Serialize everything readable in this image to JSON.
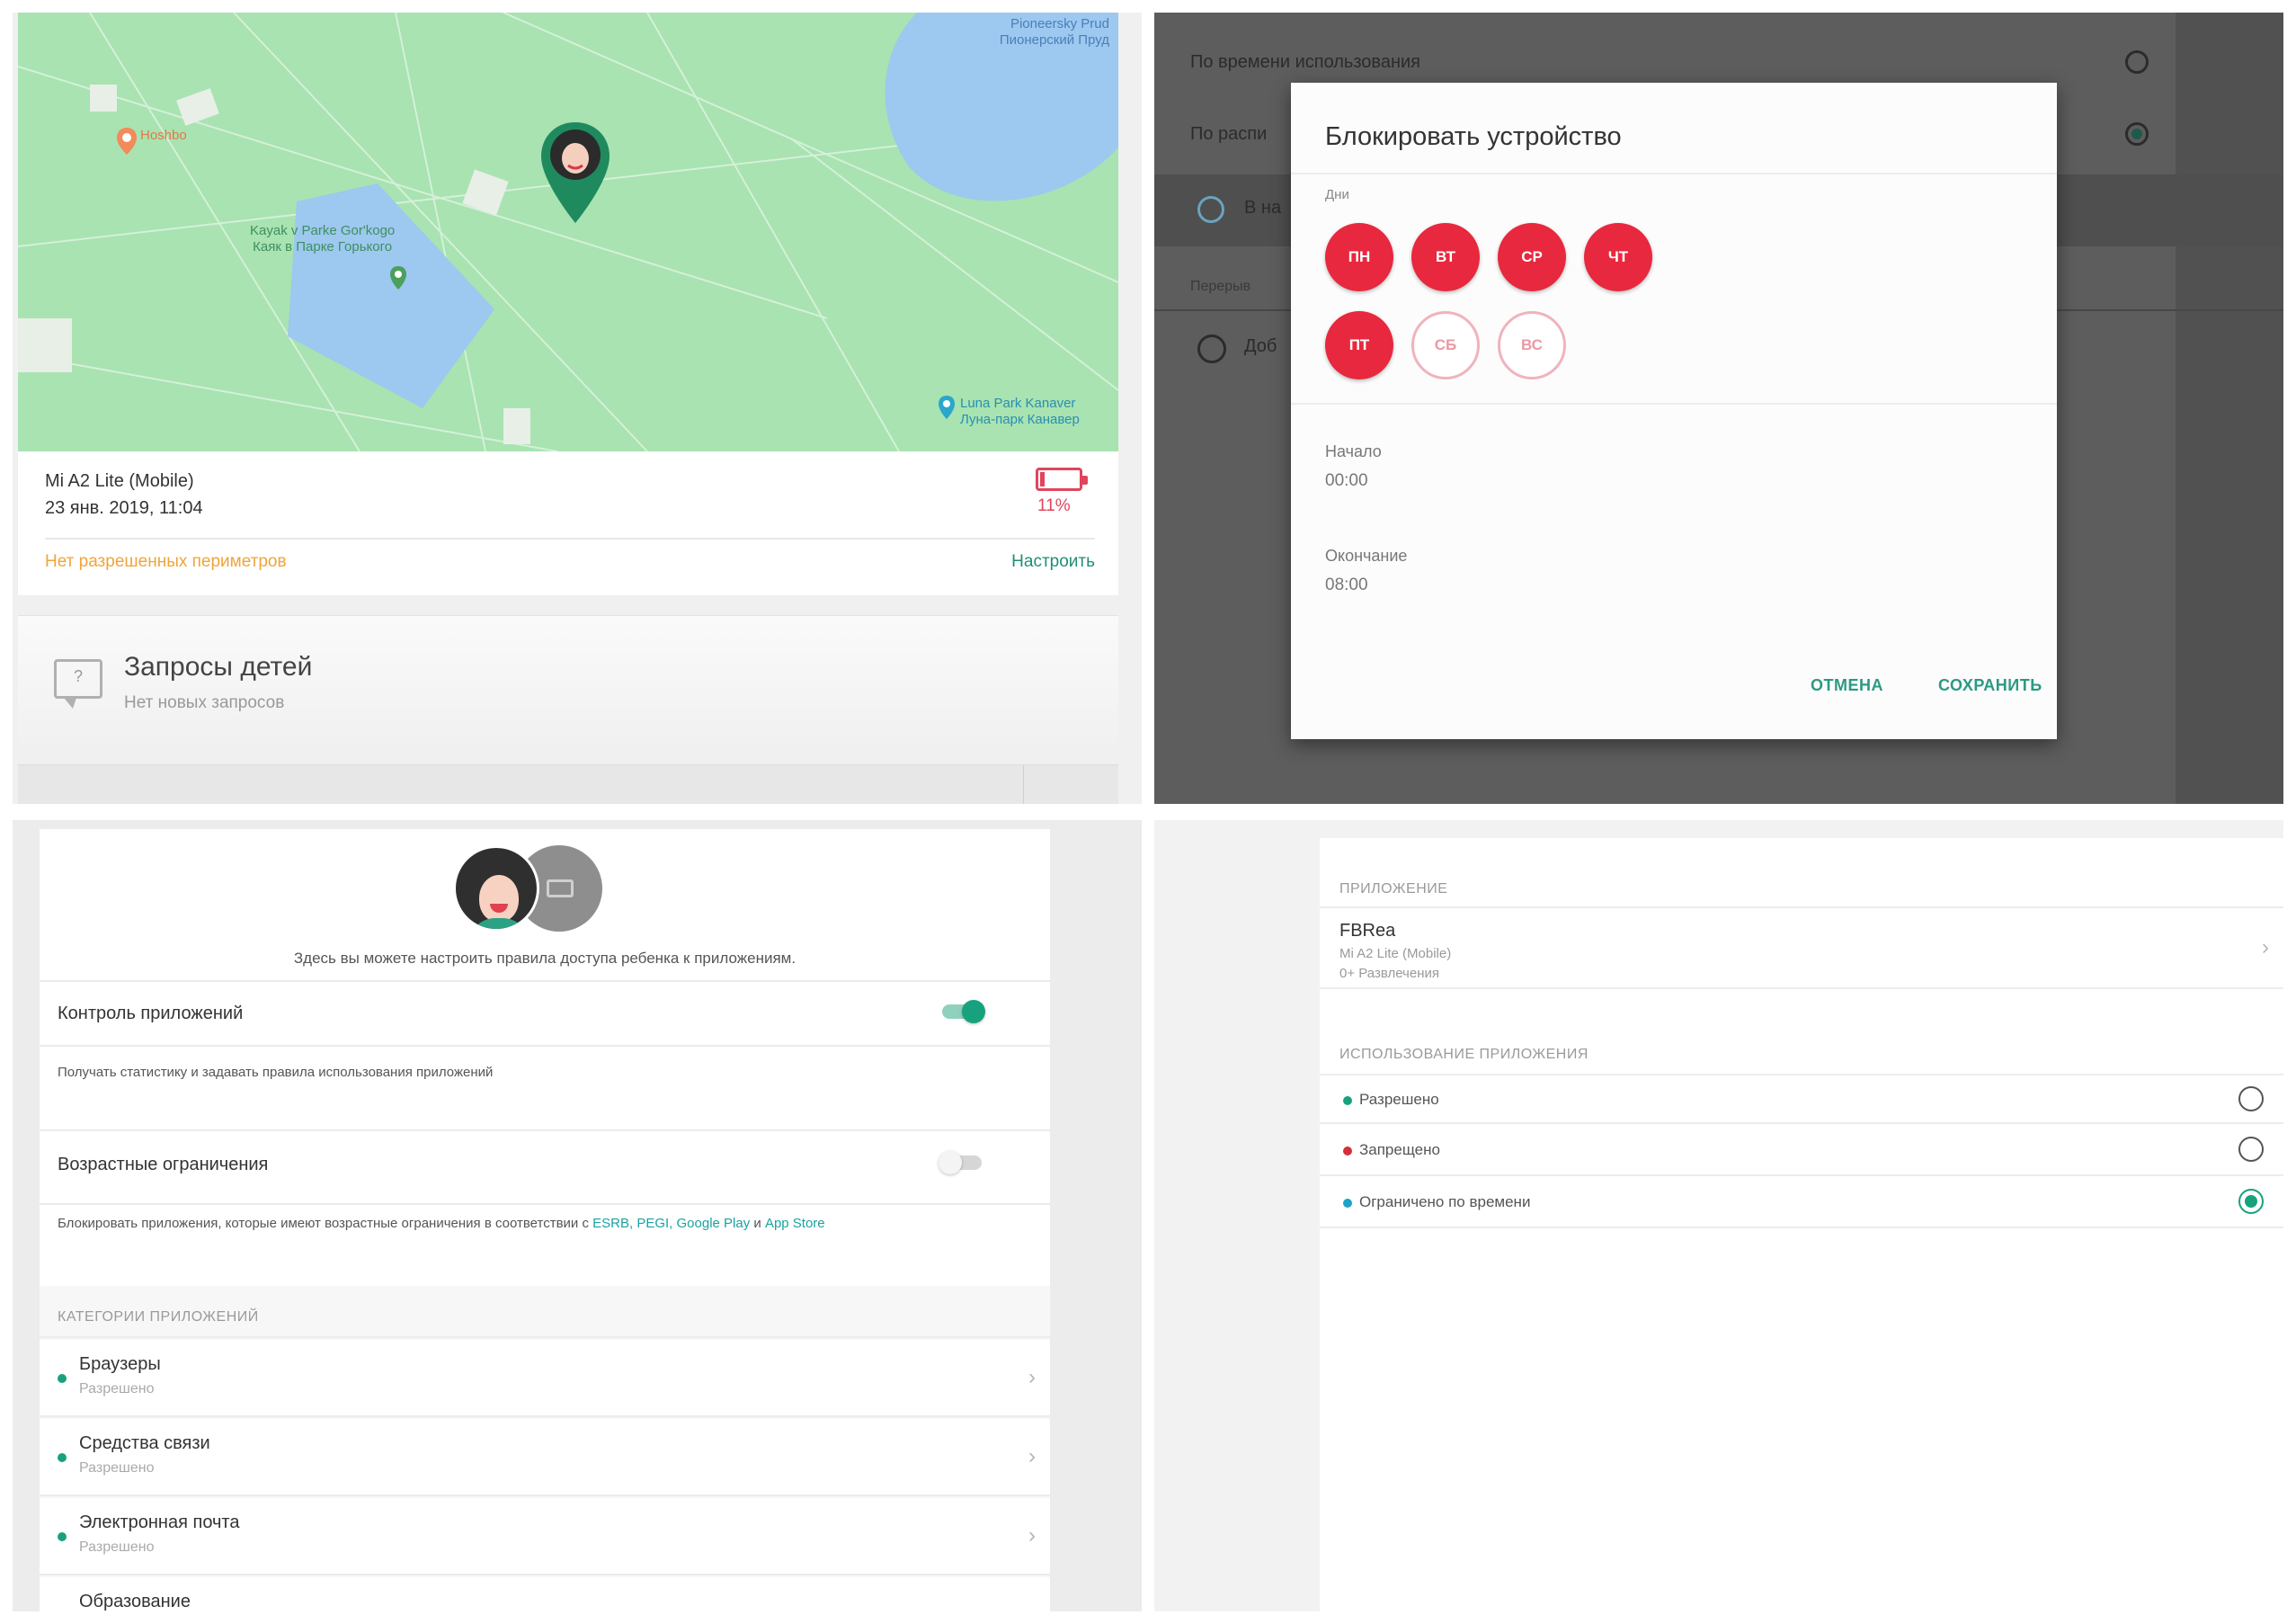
{
  "map": {
    "label_top_right": "Pioneersky Prud\nПионерский Пруд",
    "label_top_left": "Hoshbo",
    "label_kayak": "Kayak v Parke Gor'kogo\nКаяк в Парке Горького",
    "label_luna": "Luna Park Kanaver\nЛуна-парк Канавер"
  },
  "device": {
    "name": "Mi A2 Lite (Mobile)",
    "timestamp": "23 янв. 2019, 11:04",
    "battery_percent_text": "11%",
    "battery_level": 0.11,
    "no_perimeters": "Нет разрешенных периметров",
    "configure": "Настроить"
  },
  "requests": {
    "title": "Запросы детей",
    "subtitle": "Нет новых запросов",
    "icon_char": "?"
  },
  "block_settings_bg": {
    "row1": "По времени использования",
    "row2": "По распи",
    "row3": "В на",
    "row4": "Перерыв",
    "row5": "Доб"
  },
  "modal": {
    "title": "Блокировать устройство",
    "days_label": "Дни",
    "days": [
      {
        "label": "ПН",
        "on": true
      },
      {
        "label": "ВТ",
        "on": true
      },
      {
        "label": "СР",
        "on": true
      },
      {
        "label": "ЧТ",
        "on": true
      },
      {
        "label": "ПТ",
        "on": true
      },
      {
        "label": "СБ",
        "on": false
      },
      {
        "label": "ВС",
        "on": false
      }
    ],
    "start_label": "Начало",
    "start_value": "00:00",
    "end_label": "Окончание",
    "end_value": "08:00",
    "cancel": "ОТМЕНА",
    "save": "СОХРАНИТЬ"
  },
  "app_control": {
    "intro": "Здесь вы можете настроить правила доступа ребенка к приложениям.",
    "control_title": "Контроль приложений",
    "control_desc": "Получать статистику и задавать правила использования приложений",
    "control_enabled": true,
    "age_title": "Возрастные ограничения",
    "age_enabled": false,
    "age_desc_prefix": "Блокировать приложения, которые имеют возрастные ограничения в соответствии с ",
    "age_desc_links": "ESRB, PEGI, Google Play",
    "age_desc_and": " и ",
    "age_desc_last": "App Store",
    "categories_header": "КАТЕГОРИИ ПРИЛОЖЕНИЙ",
    "categories": [
      {
        "title": "Браузеры",
        "status": "Разрешено"
      },
      {
        "title": "Средства связи",
        "status": "Разрешено"
      },
      {
        "title": "Электронная почта",
        "status": "Разрешено"
      },
      {
        "title": "Образование",
        "status": ""
      }
    ]
  },
  "app_usage": {
    "app_header": "ПРИЛОЖЕНИЕ",
    "app_name": "FBRea",
    "app_device": "Mi A2 Lite (Mobile)",
    "app_rating": "0+ Развлечения",
    "usage_header": "ИСПОЛЬЗОВАНИЕ ПРИЛОЖЕНИЯ",
    "options": [
      {
        "label": "Разрешено",
        "color": "#17a27d",
        "selected": false
      },
      {
        "label": "Запрещено",
        "color": "#d62e3a",
        "selected": false
      },
      {
        "label": "Ограничено по времени",
        "color": "#1aa3c8",
        "selected": true
      }
    ]
  },
  "colors": {
    "accent": "#17a27d",
    "danger": "#e8283e",
    "warning": "#f0a43a"
  }
}
